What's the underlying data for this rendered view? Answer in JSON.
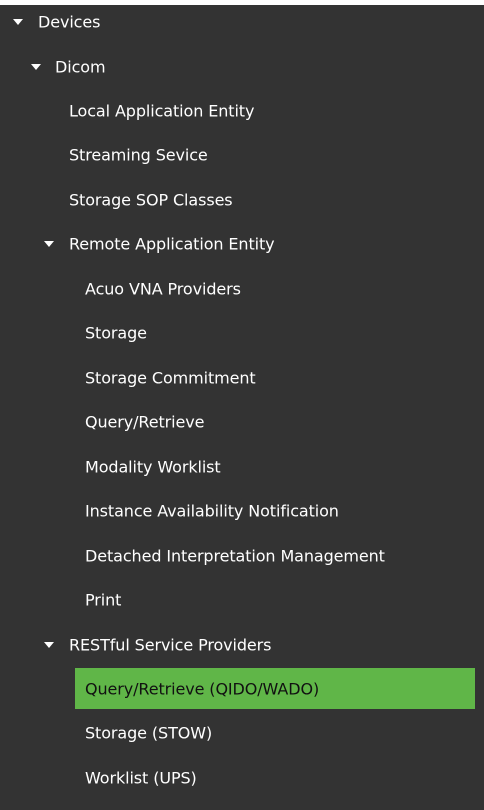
{
  "tree": {
    "devices": {
      "label": "Devices",
      "expanded": true
    },
    "dicom": {
      "label": "Dicom",
      "expanded": true
    },
    "local_ae": {
      "label": "Local Application Entity"
    },
    "streaming": {
      "label": "Streaming Sevice"
    },
    "storage_sop": {
      "label": "Storage SOP Classes"
    },
    "remote_ae": {
      "label": "Remote Application Entity",
      "expanded": true
    },
    "remote_children": [
      {
        "label": "Acuo VNA Providers"
      },
      {
        "label": "Storage"
      },
      {
        "label": "Storage Commitment"
      },
      {
        "label": "Query/Retrieve"
      },
      {
        "label": "Modality Worklist"
      },
      {
        "label": "Instance Availability Notification"
      },
      {
        "label": "Detached Interpretation Management"
      },
      {
        "label": "Print"
      }
    ],
    "restful": {
      "label": "RESTful Service Providers",
      "expanded": true
    },
    "restful_children": [
      {
        "label": "Query/Retrieve (QIDO/WADO)",
        "selected": true
      },
      {
        "label": "Storage (STOW)"
      },
      {
        "label": "Worklist (UPS)"
      }
    ]
  },
  "colors": {
    "panel_background": "#333333",
    "selected_highlight": "#60b648",
    "text": "#ffffff",
    "selected_text": "#111111"
  }
}
